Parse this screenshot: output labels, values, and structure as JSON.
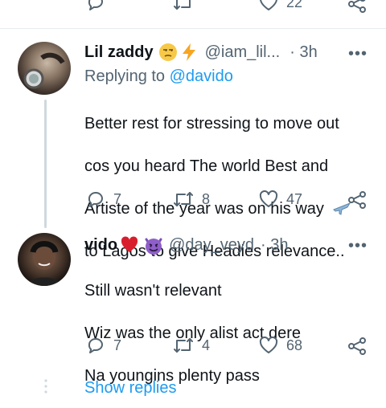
{
  "top_actions": {
    "reply_count": "",
    "retweet_count": "",
    "like_count": "22"
  },
  "tweets": [
    {
      "display_name": "Lil zaddy",
      "emojis": [
        "unamused-face-emoji",
        "lightning-emoji"
      ],
      "handle": "@iam_lil...",
      "time": "· 3h",
      "replying_prefix": "Replying to ",
      "replying_handle": "@davido",
      "lines": [
        "Better rest for stressing to move out",
        "cos you heard The world Best and",
        "Artiste of the year was on his way",
        "to Lagos to give Headies relevance.."
      ],
      "reply_count": "7",
      "retweet_count": "8",
      "like_count": "47"
    },
    {
      "display_name": "vido",
      "emojis": [
        "red-heart-emoji",
        "smiling-devil-emoji"
      ],
      "handle": "@day_veyd",
      "time": "· 3h",
      "lines": [
        "Still wasn't relevant",
        "Wiz was the only alist act dere",
        "Na youngins plenty pass"
      ],
      "reply_count": "7",
      "retweet_count": "4",
      "like_count": "68"
    }
  ],
  "show_replies": "Show replies",
  "more_glyph": "•••",
  "colors": {
    "accent": "#1d9bf0",
    "muted": "#536471",
    "text": "#0f1419",
    "divider": "#e6ecf0",
    "thread": "#cfd9de"
  }
}
